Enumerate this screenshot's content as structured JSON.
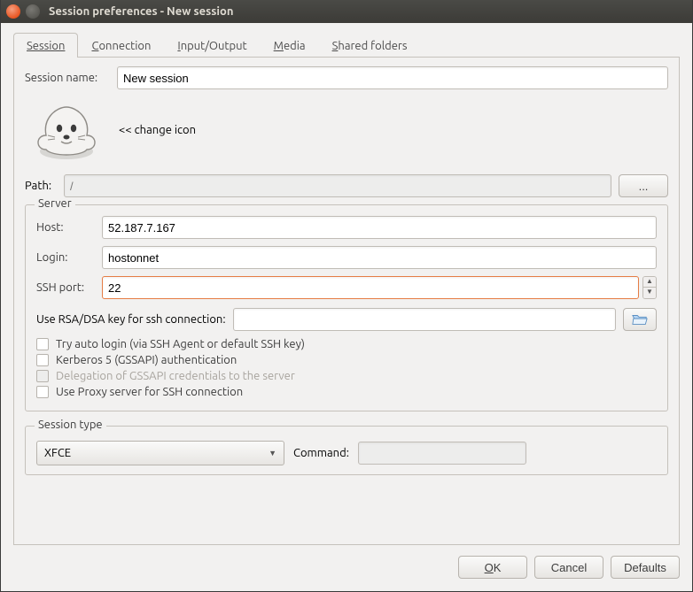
{
  "window": {
    "title": "Session preferences - New session"
  },
  "tabs": {
    "session": "Session",
    "connection": "Connection",
    "input_output": "Input/Output",
    "media": "Media",
    "shared_folders": "Shared folders"
  },
  "session_name": {
    "label": "Session name:",
    "value": "New session"
  },
  "change_icon_label": "<< change icon",
  "path": {
    "label": "Path:",
    "value": "/",
    "browse_label": "..."
  },
  "server": {
    "legend": "Server",
    "host_label": "Host:",
    "host_value": "52.187.7.167",
    "login_label": "Login:",
    "login_value": "hostonnet",
    "ssh_port_label": "SSH port:",
    "ssh_port_value": "22",
    "rsa_label": "Use RSA/DSA key for ssh connection:",
    "rsa_value": "",
    "opts": {
      "auto_login": "Try auto login (via SSH Agent or default SSH key)",
      "kerberos": "Kerberos 5 (GSSAPI) authentication",
      "gssapi_deleg": "Delegation of GSSAPI credentials to the server",
      "proxy": "Use Proxy server for SSH connection"
    }
  },
  "session_type": {
    "legend": "Session type",
    "selected": "XFCE",
    "command_label": "Command:",
    "command_value": ""
  },
  "buttons": {
    "ok": "OK",
    "cancel": "Cancel",
    "defaults": "Defaults"
  }
}
